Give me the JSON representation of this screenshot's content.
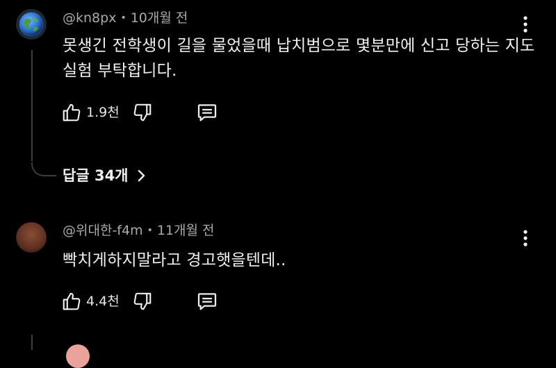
{
  "comments": [
    {
      "handle": "@kn8px",
      "separator": "•",
      "time": "10개월 전",
      "text": "못생긴 전학생이 길을 물었을때 납치범으로 몇분만에 신고 당하는 지도 실험 부탁합니다.",
      "likes": "1.9천",
      "avatar_icon": "earth-globe-icon"
    },
    {
      "handle": "@위대한-f4m",
      "separator": "•",
      "time": "11개월 전",
      "text": "빡치게하지말라고 경고햇을텐데..",
      "likes": "4.4천",
      "avatar_icon": "brown-circle-avatar"
    }
  ],
  "replies": {
    "label": "답글 34개"
  },
  "colors": {
    "background": "#000000",
    "text": "#f1f1f1",
    "meta": "#aaaaaa",
    "thread_line": "#3d3d3d"
  }
}
